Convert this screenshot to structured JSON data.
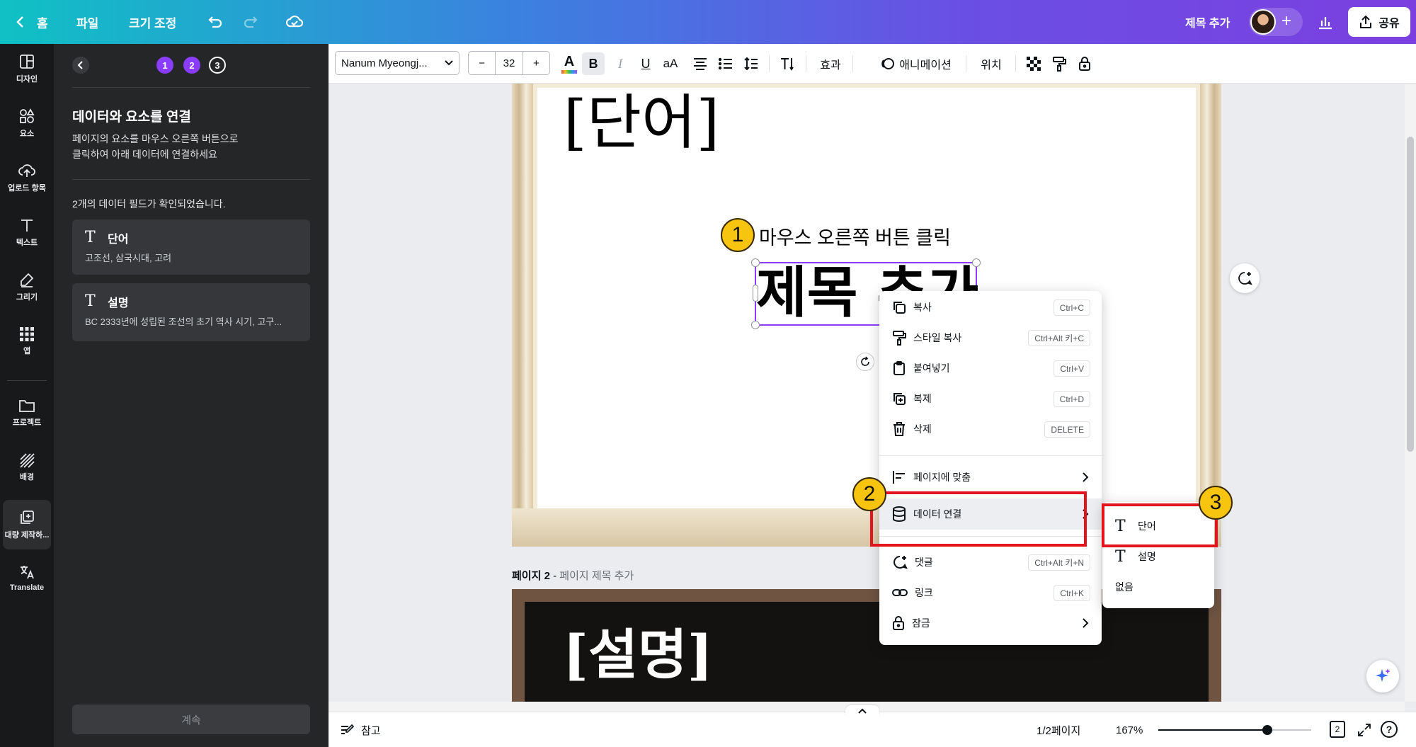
{
  "topbar": {
    "home_label": "홈",
    "file_label": "파일",
    "resize_label": "크기 조정",
    "doc_title": "제목 추가",
    "share_label": "공유"
  },
  "rail": [
    {
      "label": "디자인",
      "icon": "layout-icon"
    },
    {
      "label": "요소",
      "icon": "elements-icon"
    },
    {
      "label": "업로드 항목",
      "icon": "upload-icon"
    },
    {
      "label": "텍스트",
      "icon": "text-icon"
    },
    {
      "label": "그리기",
      "icon": "draw-icon"
    },
    {
      "label": "앱",
      "icon": "apps-icon"
    },
    {
      "label": "프로젝트",
      "icon": "folder-icon"
    },
    {
      "label": "배경",
      "icon": "background-icon"
    },
    {
      "label": "대량 제작하...",
      "icon": "bulk-create-icon"
    },
    {
      "label": "Translate",
      "icon": "translate-icon"
    }
  ],
  "panel": {
    "steps": [
      "1",
      "2",
      "3"
    ],
    "title": "데이터와 요소를 연결",
    "desc_line1": "페이지의 요소를 마우스 오른쪽 버튼으로",
    "desc_line2": "클릭하여 아래 데이터에 연결하세요",
    "found": "2개의 데이터 필드가 확인되었습니다.",
    "fields": [
      {
        "name": "단어",
        "sample": "고조선, 삼국시대, 고려"
      },
      {
        "name": "설명",
        "sample": "BC 2333년에 성립된 조선의 초기 역사 시기, 고구..."
      }
    ],
    "continue_label": "계속"
  },
  "toolbar": {
    "font": "Nanum Myeongj...",
    "size_minus": "−",
    "size": "32",
    "size_plus": "+",
    "case": "aA",
    "effects": "효과",
    "animate": "애니메이션",
    "position": "위치"
  },
  "canvas": {
    "heading_word": "[단어]",
    "annotation1": "마우스 오른쪽 버튼 클릭",
    "selected_text": "제목 추가",
    "page2_label": "페이지 2",
    "page2_dash": " - ",
    "page2_title": "페이지 제목 추가",
    "page2_text": "[설명]"
  },
  "context_menu": {
    "items": [
      {
        "label": "복사",
        "shortcut": "Ctrl+C",
        "icon": "copy-icon"
      },
      {
        "label": "스타일 복사",
        "shortcut": "Ctrl+Alt 키+C",
        "icon": "paint-roller-icon"
      },
      {
        "label": "붙여넣기",
        "shortcut": "Ctrl+V",
        "icon": "clipboard-icon"
      },
      {
        "label": "복제",
        "shortcut": "Ctrl+D",
        "icon": "duplicate-icon"
      },
      {
        "label": "삭제",
        "shortcut": "DELETE",
        "icon": "trash-icon"
      },
      {
        "label": "페이지에 맞춤",
        "icon": "align-icon"
      },
      {
        "label": "데이터 연결",
        "icon": "database-icon"
      },
      {
        "label": "댓글",
        "shortcut": "Ctrl+Alt 키+N",
        "icon": "comment-icon"
      },
      {
        "label": "링크",
        "shortcut": "Ctrl+K",
        "icon": "link-icon"
      },
      {
        "label": "잠금",
        "icon": "lock-icon"
      }
    ]
  },
  "submenu": {
    "items": [
      {
        "label": "단어"
      },
      {
        "label": "설명"
      },
      {
        "label": "없음"
      }
    ]
  },
  "badges": [
    "1",
    "2",
    "3"
  ],
  "status": {
    "notes": "참고",
    "pages": "1/2페이지",
    "zoom": "167%",
    "page_count": "2"
  },
  "colors": {
    "annotation_red": "#e3141b",
    "badge_yellow": "#f7c40f",
    "accent_purple": "#8b3dff"
  }
}
